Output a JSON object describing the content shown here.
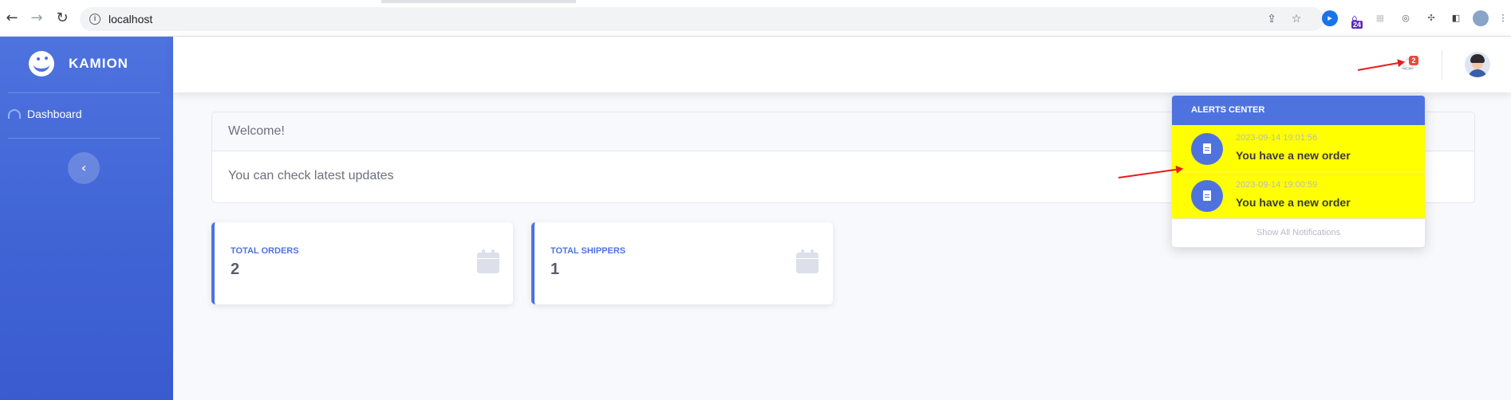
{
  "browser": {
    "url": "localhost",
    "extensions_badge": "24"
  },
  "sidebar": {
    "brand": "KAMION",
    "items": [
      {
        "label": "Dashboard"
      }
    ]
  },
  "topbar": {
    "notification_count": "2"
  },
  "welcome": {
    "title": "Welcome!",
    "body": "You can check latest updates"
  },
  "stats": [
    {
      "label": "TOTAL ORDERS",
      "value": "2"
    },
    {
      "label": "TOTAL SHIPPERS",
      "value": "1"
    }
  ],
  "alerts": {
    "header": "ALERTS CENTER",
    "items": [
      {
        "time": "2023-09-14 19:01:56",
        "text": "You have a new order"
      },
      {
        "time": "2023-09-14 19:00:59",
        "text": "You have a new order"
      }
    ],
    "footer": "Show All Notifications",
    "highlight_color": "#ffff00"
  },
  "colors": {
    "primary": "#4e73df",
    "danger_badge": "#e74a3b",
    "annotation_arrow": "#e51d1d"
  }
}
